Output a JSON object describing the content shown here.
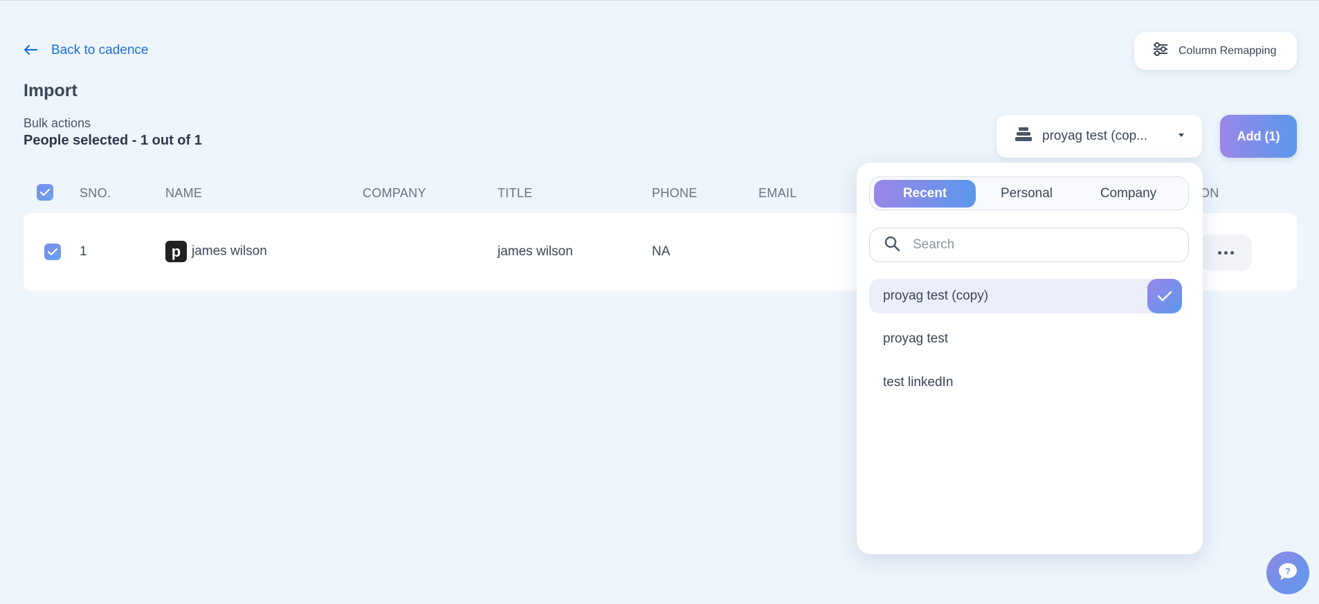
{
  "header": {
    "back_label": "Back to cadence",
    "title": "Import",
    "column_remap_label": "Column Remapping"
  },
  "bulk": {
    "label": "Bulk actions",
    "selected_text": "People selected - 1 out of 1"
  },
  "cadence_select": {
    "value": "proyag test (cop..."
  },
  "add_button": {
    "label": "Add (1)"
  },
  "table": {
    "columns": [
      "SNO.",
      "NAME",
      "COMPANY",
      "TITLE",
      "PHONE",
      "EMAIL",
      "ON"
    ],
    "rows": [
      {
        "sno": "1",
        "name": "james wilson",
        "company": "",
        "title": "james wilson",
        "phone": "NA",
        "email": "",
        "checked": true
      }
    ]
  },
  "dropdown": {
    "tabs": [
      {
        "label": "Recent",
        "active": true
      },
      {
        "label": "Personal",
        "active": false
      },
      {
        "label": "Company",
        "active": false
      }
    ],
    "search_placeholder": "Search",
    "options": [
      {
        "label": "proyag test (copy)",
        "selected": true
      },
      {
        "label": "proyag test",
        "selected": false
      },
      {
        "label": "test linkedIn",
        "selected": false
      }
    ]
  },
  "colors": {
    "background": "#eef5fc",
    "accent_start": "#9a86e8",
    "accent_end": "#5b98ec",
    "link": "#1c6fd6"
  },
  "icons": {
    "back": "arrow-left-icon",
    "remap": "sliders-icon",
    "cadence": "stack-icon",
    "search": "search-icon",
    "check": "check-icon",
    "more": "more-horizontal-icon",
    "help": "chat-question-icon"
  }
}
